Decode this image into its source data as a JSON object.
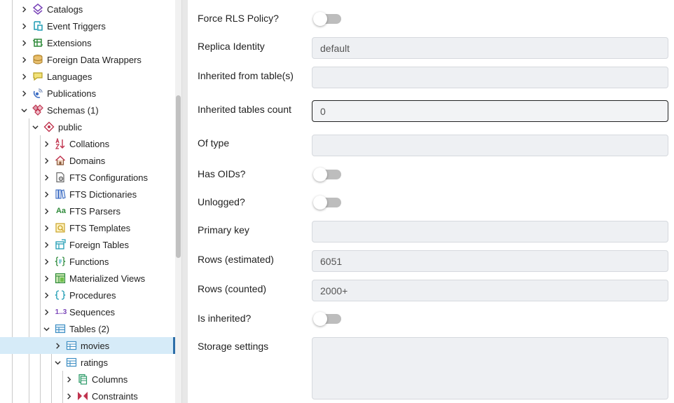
{
  "tree": {
    "items": [
      {
        "label": "Catalogs"
      },
      {
        "label": "Event Triggers"
      },
      {
        "label": "Extensions"
      },
      {
        "label": "Foreign Data Wrappers"
      },
      {
        "label": "Languages"
      },
      {
        "label": "Publications"
      },
      {
        "label": "Schemas (1)"
      },
      {
        "label": "public"
      },
      {
        "label": "Collations"
      },
      {
        "label": "Domains"
      },
      {
        "label": "FTS Configurations"
      },
      {
        "label": "FTS Dictionaries"
      },
      {
        "label": "FTS Parsers"
      },
      {
        "label": "FTS Templates"
      },
      {
        "label": "Foreign Tables"
      },
      {
        "label": "Functions"
      },
      {
        "label": "Materialized Views"
      },
      {
        "label": "Procedures"
      },
      {
        "label": "Sequences"
      },
      {
        "label": "Tables (2)"
      },
      {
        "label": "movies"
      },
      {
        "label": "ratings"
      },
      {
        "label": "Columns"
      },
      {
        "label": "Constraints"
      }
    ],
    "icon_texts": {
      "fts_parsers": "Aa",
      "sequences": "1..3"
    }
  },
  "properties": {
    "force_rls": {
      "label": "Force RLS Policy?",
      "on": false
    },
    "replica_identity": {
      "label": "Replica Identity",
      "value": "default"
    },
    "inherited_from": {
      "label": "Inherited from table(s)",
      "value": ""
    },
    "inherited_count": {
      "label": "Inherited tables count",
      "value": "0"
    },
    "of_type": {
      "label": "Of type",
      "value": ""
    },
    "has_oids": {
      "label": "Has OIDs?",
      "on": false
    },
    "unlogged": {
      "label": "Unlogged?",
      "on": false
    },
    "primary_key": {
      "label": "Primary key",
      "value": ""
    },
    "rows_estimated": {
      "label": "Rows (estimated)",
      "value": "6051"
    },
    "rows_counted": {
      "label": "Rows (counted)",
      "value": "2000+"
    },
    "is_inherited": {
      "label": "Is inherited?",
      "on": false
    },
    "storage_settings": {
      "label": "Storage settings",
      "value": ""
    }
  },
  "colors": {
    "selection": "#d6ebf8",
    "selection_bar": "#2d6ea8",
    "field_bg": "#eef0f3",
    "switch_off": "#bdbdbd"
  }
}
